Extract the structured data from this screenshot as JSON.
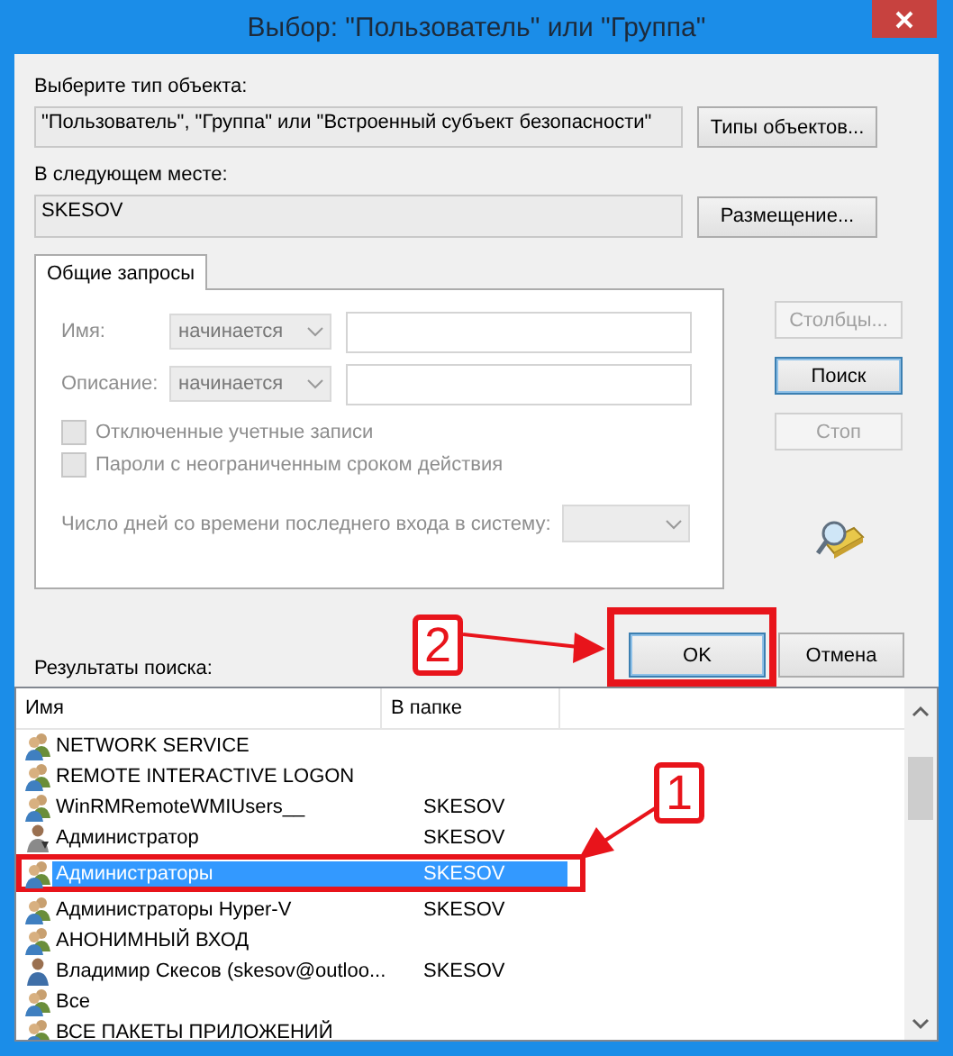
{
  "window": {
    "title": "Выбор: \"Пользователь\" или \"Группа\""
  },
  "object_type": {
    "label": "Выберите тип объекта:",
    "value": "\"Пользователь\", \"Группа\" или \"Встроенный субъект безопасности\"",
    "button": "Типы объектов..."
  },
  "location": {
    "label": "В следующем месте:",
    "value": "SKESOV",
    "button": "Размещение..."
  },
  "tabs": [
    {
      "label": "Общие запросы",
      "selected": true
    }
  ],
  "query": {
    "fields": [
      {
        "label": "Имя:",
        "condition": "начинается"
      },
      {
        "label": "Описание:",
        "condition": "начинается"
      }
    ],
    "checkboxes": [
      {
        "label": "Отключенные учетные записи",
        "checked": false
      },
      {
        "label": "Пароли с неограниченным сроком действия",
        "checked": false
      }
    ],
    "days_label": "Число дней со времени последнего входа в систему:",
    "disabled": true
  },
  "side_buttons": [
    {
      "label": "Столбцы...",
      "disabled": true,
      "default": false
    },
    {
      "label": "Поиск",
      "disabled": false,
      "default": true
    },
    {
      "label": "Стоп",
      "disabled": true,
      "default": false
    }
  ],
  "buttons": [
    {
      "label": "OK",
      "default": true
    },
    {
      "label": "Отмена",
      "default": false
    }
  ],
  "results": {
    "label": "Результаты поиска:",
    "columns": [
      "Имя",
      "В папке"
    ],
    "rows": [
      {
        "name": "NETWORK SERVICE",
        "folder": "",
        "kind": "group",
        "selected": false
      },
      {
        "name": "REMOTE INTERACTIVE LOGON",
        "folder": "",
        "kind": "group",
        "selected": false
      },
      {
        "name": "WinRMRemoteWMIUsers__",
        "folder": "SKESOV",
        "kind": "group",
        "selected": false
      },
      {
        "name": "Администратор",
        "folder": "SKESOV",
        "kind": "user-disabled",
        "selected": false
      },
      {
        "name": "Администраторы",
        "folder": "SKESOV",
        "kind": "group",
        "selected": true
      },
      {
        "name": "Администраторы Hyper-V",
        "folder": "SKESOV",
        "kind": "group",
        "selected": false
      },
      {
        "name": "АНОНИМНЫЙ ВХОД",
        "folder": "",
        "kind": "group",
        "selected": false
      },
      {
        "name": "Владимир Скесов (skesov@outloo...",
        "folder": "SKESOV",
        "kind": "user",
        "selected": false
      },
      {
        "name": "Все",
        "folder": "",
        "kind": "group",
        "selected": false
      },
      {
        "name": "ВСЕ ПАКЕТЫ ПРИЛОЖЕНИЙ",
        "folder": "",
        "kind": "group",
        "selected": false
      }
    ]
  },
  "annotations": [
    {
      "number": "2",
      "kind": "button"
    },
    {
      "number": "1",
      "kind": "row"
    }
  ]
}
